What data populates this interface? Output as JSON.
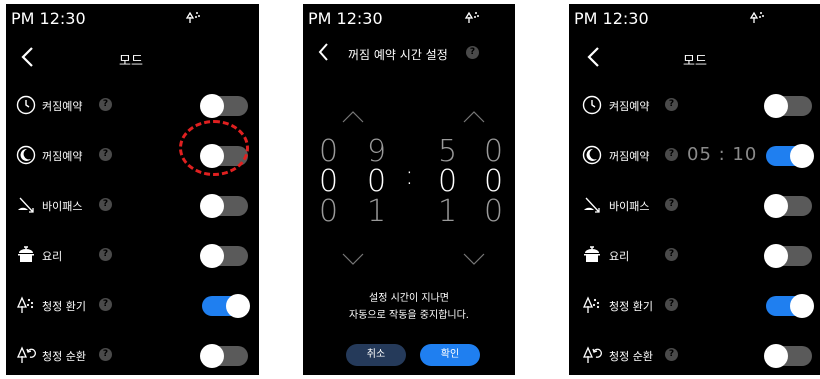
{
  "status": {
    "time": "PM 12:30"
  },
  "screen1": {
    "title": "모드",
    "items": [
      {
        "label": "켜짐예약",
        "icon": "clock-icon",
        "toggle": "off"
      },
      {
        "label": "꺼짐예약",
        "icon": "moon-icon",
        "toggle": "off"
      },
      {
        "label": "바이패스",
        "icon": "bypass-icon",
        "toggle": "off"
      },
      {
        "label": "요리",
        "icon": "cooking-pot-icon",
        "toggle": "off"
      },
      {
        "label": "청정 환기",
        "icon": "fresh-ventilation-icon",
        "toggle": "on"
      },
      {
        "label": "청정 순환",
        "icon": "air-circulation-icon",
        "toggle": "off"
      }
    ],
    "help_glyph": "?"
  },
  "screen2": {
    "title": "꺼짐 예약 시간 설정",
    "help_glyph": "?",
    "hour_prev": [
      "0",
      "9"
    ],
    "hour_cur": [
      "0",
      "0"
    ],
    "hour_next": [
      "0",
      "1"
    ],
    "colon": ":",
    "min_prev": [
      "5",
      "0"
    ],
    "min_cur": [
      "0",
      "0"
    ],
    "min_next": [
      "1",
      "0"
    ],
    "message_line1": "설정 시간이 지나면",
    "message_line2": "자동으로 작동을 중지합니다.",
    "cancel_label": "취소",
    "confirm_label": "확인"
  },
  "screen3": {
    "title": "모드",
    "scheduled_time": "05 : 10",
    "items": [
      {
        "label": "켜짐예약",
        "toggle": "off"
      },
      {
        "label": "꺼짐예약",
        "toggle": "on"
      },
      {
        "label": "바이패스",
        "toggle": "off"
      },
      {
        "label": "요리",
        "toggle": "off"
      },
      {
        "label": "청정 환기",
        "toggle": "on"
      },
      {
        "label": "청정 순환",
        "toggle": "off"
      }
    ],
    "help_glyph": "?"
  },
  "colors": {
    "accent": "#1f7ff0",
    "highlight": "#e02020",
    "toggle_off": "#5a5a5a",
    "background": "#000000"
  }
}
